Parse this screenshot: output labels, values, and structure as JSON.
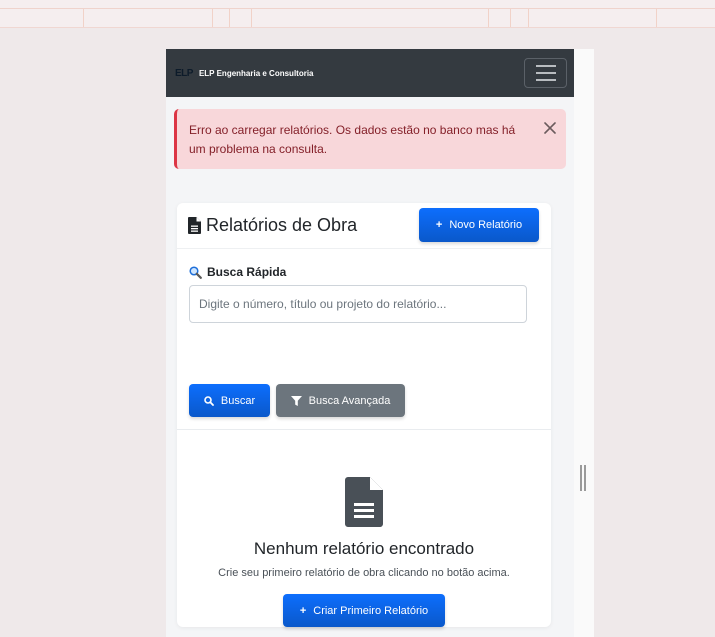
{
  "navbar": {
    "logo_text": "ELP",
    "brand_name": "ELP Engenharia e Consultoria"
  },
  "alert": {
    "message": "Erro ao carregar relatórios. Os dados estão no banco mas há um problema na consulta."
  },
  "reports": {
    "title": "Relatórios de Obra",
    "new_button": "Novo Relatório",
    "search_label": "Busca Rápida",
    "search_placeholder": "Digite o número, título ou projeto do relatório...",
    "search_value": "",
    "search_button": "Buscar",
    "advanced_button": "Busca Avançada",
    "empty_title": "Nenhum relatório encontrado",
    "empty_text": "Crie seu primeiro relatório de obra clicando no botão acima.",
    "create_first_button": "Criar Primeiro Relatório"
  },
  "colors": {
    "primary": "#0d6efd",
    "secondary": "#6c757d",
    "navbar": "#343a40",
    "alert_bg": "#f8d7da",
    "alert_text": "#842029"
  },
  "icons": [
    "file-icon",
    "plus-icon",
    "magnifier-icon",
    "search-icon",
    "filter-icon",
    "close-icon",
    "menu-icon"
  ]
}
